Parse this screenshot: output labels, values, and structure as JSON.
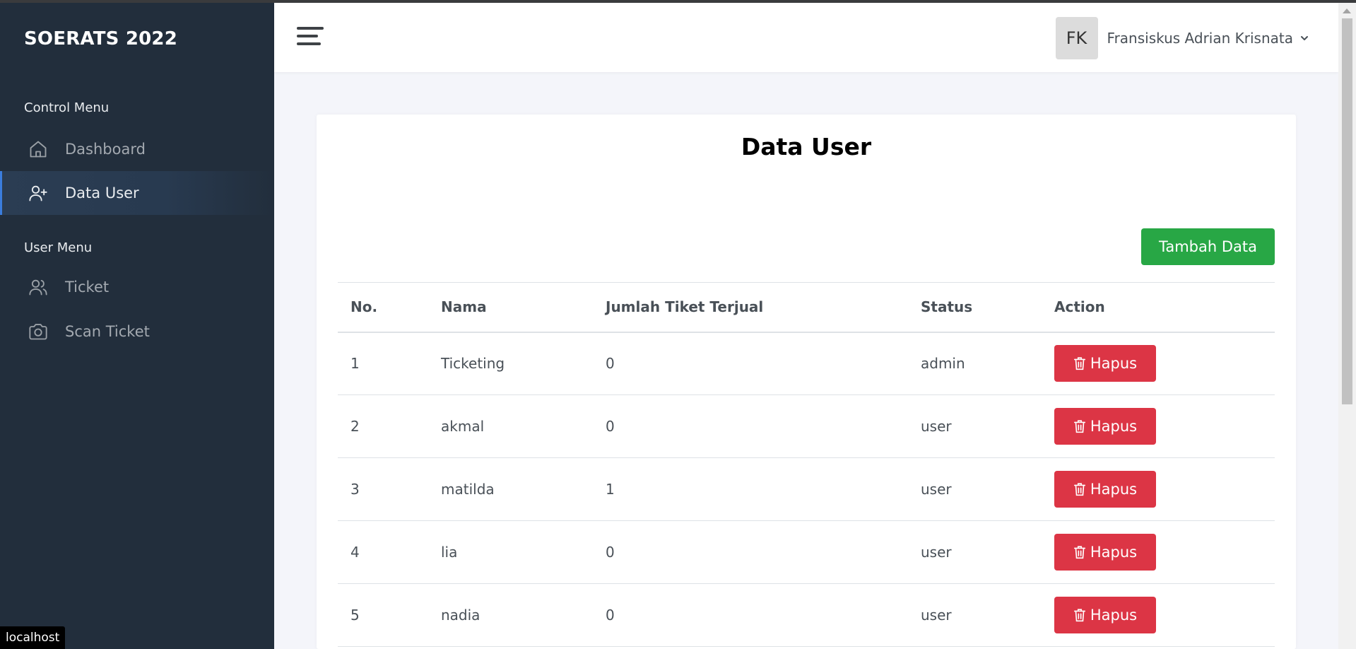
{
  "sidebar": {
    "brand": "SOERATS 2022",
    "control_menu_title": "Control Menu",
    "user_menu_title": "User Menu",
    "items": [
      {
        "label": "Dashboard",
        "icon": "home-icon",
        "active": false
      },
      {
        "label": "Data User",
        "icon": "user-plus-icon",
        "active": true
      },
      {
        "label": "Ticket",
        "icon": "users-icon",
        "active": false
      },
      {
        "label": "Scan Ticket",
        "icon": "camera-icon",
        "active": false
      }
    ]
  },
  "topbar": {
    "menu_icon": "hamburger-icon",
    "avatar_initials": "FK",
    "username": "Fransiskus Adrian Krisnata"
  },
  "main": {
    "title_bold": "Data",
    "title_rest": "User",
    "add_button_label": "Tambah Data",
    "table": {
      "headers": [
        "No.",
        "Nama",
        "Jumlah Tiket Terjual",
        "Status",
        "Action"
      ],
      "delete_label": "Hapus",
      "rows": [
        {
          "no": "1",
          "nama": "Ticketing",
          "jumlah": "0",
          "status": "admin"
        },
        {
          "no": "2",
          "nama": "akmal",
          "jumlah": "0",
          "status": "user"
        },
        {
          "no": "3",
          "nama": "matilda",
          "jumlah": "1",
          "status": "user"
        },
        {
          "no": "4",
          "nama": "lia",
          "jumlah": "0",
          "status": "user"
        },
        {
          "no": "5",
          "nama": "nadia",
          "jumlah": "0",
          "status": "user"
        }
      ]
    }
  },
  "status_bar": {
    "url": "localhost"
  },
  "colors": {
    "sidebar_bg": "#222e3c",
    "accent": "#3b7ddd",
    "add_button": "#28a745",
    "delete_button": "#dc3545"
  }
}
